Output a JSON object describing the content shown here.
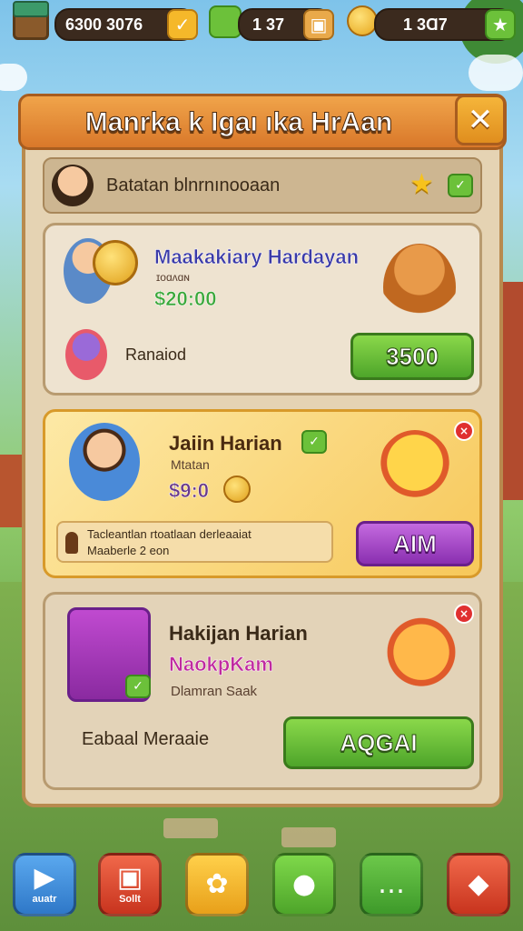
{
  "resources": [
    {
      "value": "6300 3076"
    },
    {
      "value": "1 37"
    },
    {
      "value": "1   3Ɑ7"
    }
  ],
  "panel": {
    "title": "Manrka k Igaı ıka HrAan",
    "close_symbol": "✕"
  },
  "subbar": {
    "label": "Batatan blnrnınooaan"
  },
  "card1": {
    "title": "Maakakiary Hardayan",
    "subtitle": "ɪoɑʌɑɴ",
    "amount": "$20:00",
    "secondary_label": "Ranaiod",
    "button_label": "3500"
  },
  "card2": {
    "title": "Jaiin Harian",
    "subtitle": "Mtatan",
    "amount": "$9:0",
    "info_line1": "Tacleantlan rtoatlaan derleaaiat",
    "info_line2": "Maaberle 2 eon",
    "button_label": "AIM"
  },
  "card3": {
    "title": "Hakijan Harian",
    "highlight": "NaokpKam",
    "subtitle": "Dlamran Saak",
    "secondary_label": "Eabaal Meraaie",
    "button_label": "AQGAI"
  },
  "bottom_nav": [
    {
      "label": "auatr",
      "icon": "play-icon",
      "color": "#3f8fdc"
    },
    {
      "label": "Sollt",
      "icon": "shop-box-icon",
      "color": "#e0452e"
    },
    {
      "label": "",
      "icon": "puzzle-icon",
      "color": "#f5b82a"
    },
    {
      "label": "",
      "icon": "chat-bubble-icon",
      "color": "#5fb83a"
    },
    {
      "label": "",
      "icon": "message-icon",
      "color": "#4ca83a"
    },
    {
      "label": "",
      "icon": "gift-icon",
      "color": "#e0452e"
    }
  ]
}
